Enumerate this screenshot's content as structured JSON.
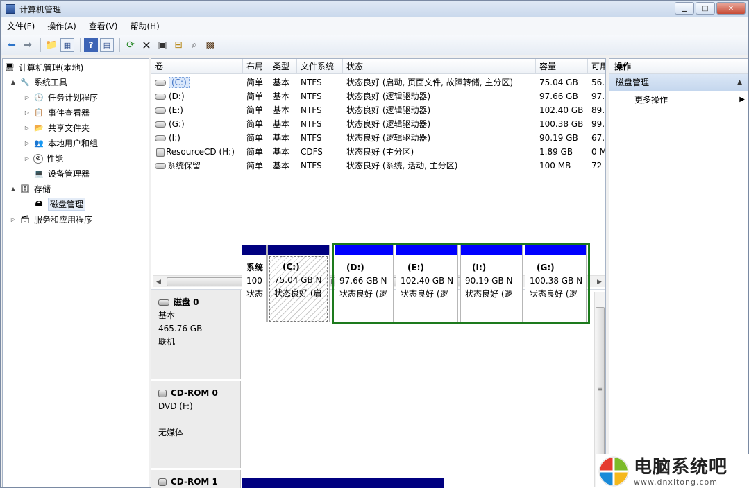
{
  "window": {
    "title": "计算机管理"
  },
  "menu": [
    "文件(F)",
    "操作(A)",
    "查看(V)",
    "帮助(H)"
  ],
  "toolbar_icons": [
    "back-icon",
    "forward-icon",
    "up-folder-icon",
    "show-hide-tree-icon",
    "help-icon",
    "console-tree-icon",
    "refresh-icon",
    "delete-icon",
    "properties-icon",
    "open-icon",
    "search-icon",
    "export-icon"
  ],
  "tree": [
    {
      "label": "计算机管理(本地)",
      "level": 0,
      "exp": "",
      "icon": "computer-management-icon"
    },
    {
      "label": "系统工具",
      "level": 1,
      "exp": "▲",
      "icon": "tools-icon"
    },
    {
      "label": "任务计划程序",
      "level": 2,
      "exp": "▷",
      "icon": "clock-icon"
    },
    {
      "label": "事件查看器",
      "level": 2,
      "exp": "▷",
      "icon": "event-viewer-icon"
    },
    {
      "label": "共享文件夹",
      "level": 2,
      "exp": "▷",
      "icon": "shared-folder-icon"
    },
    {
      "label": "本地用户和组",
      "level": 2,
      "exp": "▷",
      "icon": "users-icon"
    },
    {
      "label": "性能",
      "level": 2,
      "exp": "▷",
      "icon": "performance-icon"
    },
    {
      "label": "设备管理器",
      "level": 2,
      "exp": "",
      "icon": "device-manager-icon"
    },
    {
      "label": "存储",
      "level": 1,
      "exp": "▲",
      "icon": "storage-icon"
    },
    {
      "label": "磁盘管理",
      "level": 2,
      "exp": "",
      "icon": "disk-management-icon",
      "selected": true
    },
    {
      "label": "服务和应用程序",
      "level": 1,
      "exp": "▷",
      "icon": "services-icon"
    }
  ],
  "columns": [
    "卷",
    "布局",
    "类型",
    "文件系统",
    "状态",
    "容量",
    "可用"
  ],
  "volumes": [
    {
      "name": "(C:)",
      "layout": "简单",
      "type": "基本",
      "fs": "NTFS",
      "status": "状态良好 (启动, 页面文件, 故障转储, 主分区)",
      "capacity": "75.04 GB",
      "free": "56.",
      "cd": false,
      "selected": true
    },
    {
      "name": "(D:)",
      "layout": "简单",
      "type": "基本",
      "fs": "NTFS",
      "status": "状态良好 (逻辑驱动器)",
      "capacity": "97.66 GB",
      "free": "97.",
      "cd": false
    },
    {
      "name": "(E:)",
      "layout": "简单",
      "type": "基本",
      "fs": "NTFS",
      "status": "状态良好 (逻辑驱动器)",
      "capacity": "102.40 GB",
      "free": "89.",
      "cd": false
    },
    {
      "name": "(G:)",
      "layout": "简单",
      "type": "基本",
      "fs": "NTFS",
      "status": "状态良好 (逻辑驱动器)",
      "capacity": "100.38 GB",
      "free": "99.",
      "cd": false
    },
    {
      "name": "(I:)",
      "layout": "简单",
      "type": "基本",
      "fs": "NTFS",
      "status": "状态良好 (逻辑驱动器)",
      "capacity": "90.19 GB",
      "free": "67.",
      "cd": false
    },
    {
      "name": "ResourceCD (H:)",
      "layout": "简单",
      "type": "基本",
      "fs": "CDFS",
      "status": "状态良好 (主分区)",
      "capacity": "1.89 GB",
      "free": "0 M",
      "cd": true
    },
    {
      "name": "系统保留",
      "layout": "简单",
      "type": "基本",
      "fs": "NTFS",
      "status": "状态良好 (系统, 活动, 主分区)",
      "capacity": "100 MB",
      "free": "72",
      "cd": false
    }
  ],
  "scroll_grip": "III",
  "disk0": {
    "name": "磁盘 0",
    "type": "基本",
    "size": "465.76 GB",
    "state": "联机"
  },
  "partitions": [
    {
      "name": "系统",
      "size": "100",
      "status": "状态"
    },
    {
      "name": "(C:)",
      "size": "75.04 GB N",
      "status": "状态良好 (启"
    },
    {
      "name": "(D:)",
      "size": "97.66 GB N",
      "status": "状态良好 (逻"
    },
    {
      "name": "(E:)",
      "size": "102.40 GB N",
      "status": "状态良好 (逻"
    },
    {
      "name": "(I:)",
      "size": "90.19 GB N",
      "status": "状态良好 (逻"
    },
    {
      "name": "(G:)",
      "size": "100.38 GB N",
      "status": "状态良好 (逻"
    }
  ],
  "cdrom0": {
    "name": "CD-ROM 0",
    "type": "DVD (F:)",
    "media": "无媒体"
  },
  "cdrom1": {
    "name": "CD-ROM 1"
  },
  "actions": {
    "header": "操作",
    "section": "磁盘管理",
    "more": "更多操作"
  },
  "watermark": {
    "cn": "电脑系统吧",
    "url": "www.dnxitong.com"
  }
}
